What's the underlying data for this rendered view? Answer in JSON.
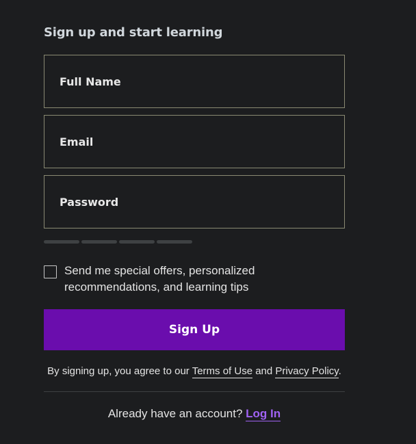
{
  "form": {
    "heading": "Sign up and start learning",
    "fields": {
      "full_name_placeholder": "Full Name",
      "email_placeholder": "Email",
      "password_placeholder": "Password"
    },
    "optin": {
      "checked": false,
      "label": "Send me special offers, personalized recommendations, and learning tips"
    },
    "signup_button": "Sign Up",
    "legal": {
      "prefix": "By signing up, you agree to our ",
      "terms_link": "Terms of Use",
      "middle": " and ",
      "privacy_link": "Privacy Policy",
      "suffix": "."
    },
    "login": {
      "prompt": "Already have an account? ",
      "link": "Log In"
    }
  },
  "colors": {
    "background": "#1c1d1f",
    "accent": "#6a0dad",
    "link_accent": "#a062f2",
    "field_border": "#8a8a73"
  }
}
